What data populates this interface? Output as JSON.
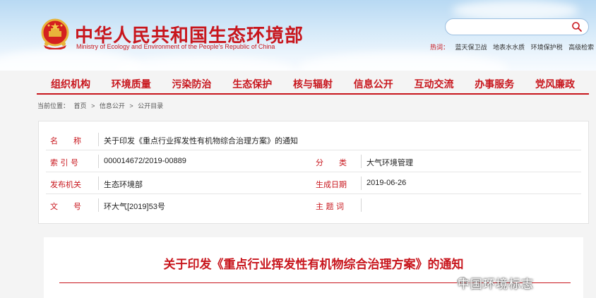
{
  "site": {
    "title_cn": "中华人民共和国生态环境部",
    "title_en": "Ministry of Ecology and Environment of the People's Republic of China",
    "accent_color": "#c8161d"
  },
  "search": {
    "placeholder": "",
    "icon": "search-icon"
  },
  "hot_topics": {
    "label": "热词：",
    "links": [
      "蓝天保卫战",
      "地表水水质",
      "环境保护税",
      "高级检索"
    ]
  },
  "nav": {
    "items": [
      "组织机构",
      "环境质量",
      "污染防治",
      "生态保护",
      "核与辐射",
      "信息公开",
      "互动交流",
      "办事服务",
      "党风廉政"
    ]
  },
  "breadcrumb": {
    "prefix": "当前位置：",
    "items": [
      "首页",
      "信息公开",
      "公开目录"
    ],
    "separator": ">"
  },
  "document_info": {
    "name_label": "名　　称",
    "name_value": "关于印发《重点行业挥发性有机物综合治理方案》的通知",
    "index_label": "索 引 号",
    "index_value": "000014672/2019-00889",
    "category_label": "分　　类",
    "category_value": "大气环境管理",
    "issuer_label": "发布机关",
    "issuer_value": "生态环境部",
    "date_label": "生成日期",
    "date_value": "2019-06-26",
    "doc_no_label": "文　　号",
    "doc_no_value": "环大气[2019]53号",
    "subject_label": "主 题 词",
    "subject_value": ""
  },
  "article": {
    "title": "关于印发《重点行业挥发性有机物综合治理方案》的通知"
  },
  "watermark": {
    "text": "中国环境标志",
    "icon": "wechat-icon"
  }
}
